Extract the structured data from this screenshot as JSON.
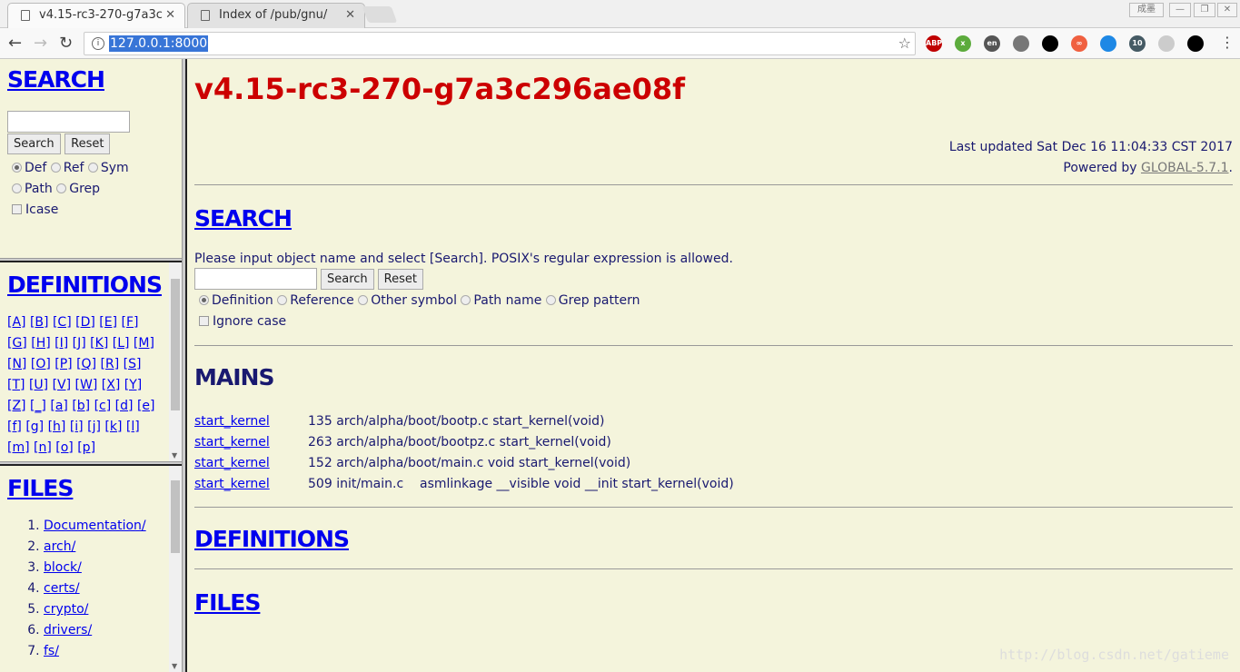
{
  "browser": {
    "tabs": [
      {
        "title": "v4.15-rc3-270-g7a3c",
        "active": true
      },
      {
        "title": "Index of /pub/gnu/",
        "active": false
      }
    ],
    "window_buttons": [
      "成墨",
      "—",
      "❐",
      "✕"
    ],
    "url": "127.0.0.1:8000",
    "extensions": [
      {
        "name": "adblock-plus-icon",
        "label": "ABP",
        "color": "#c00000"
      },
      {
        "name": "extension-x-icon",
        "label": "x",
        "color": "#5cab3c"
      },
      {
        "name": "translate-en-icon",
        "label": "en",
        "color": "#555555"
      },
      {
        "name": "extension-script-icon",
        "label": "",
        "color": "#777777"
      },
      {
        "name": "ring-icon",
        "label": "",
        "color": "#000000"
      },
      {
        "name": "infinity-icon",
        "label": "∞",
        "color": "#f06040"
      },
      {
        "name": "key-icon",
        "label": "",
        "color": "#1e88e5"
      },
      {
        "name": "star-badge-icon",
        "label": "10",
        "color": "#455a64"
      },
      {
        "name": "puzzle-icon",
        "label": "",
        "color": "#cccccc"
      },
      {
        "name": "gnome-foot-icon",
        "label": "",
        "color": "#000000"
      }
    ]
  },
  "left": {
    "search": {
      "title": "SEARCH",
      "search_btn": "Search",
      "reset_btn": "Reset",
      "radios": [
        "Def",
        "Ref",
        "Sym",
        "Path",
        "Grep"
      ],
      "checkbox": "Icase"
    },
    "definitions": {
      "title": "DEFINITIONS",
      "letters": [
        "[A]",
        "[B]",
        "[C]",
        "[D]",
        "[E]",
        "[F]",
        "[G]",
        "[H]",
        "[I]",
        "[J]",
        "[K]",
        "[L]",
        "[M]",
        "[N]",
        "[O]",
        "[P]",
        "[Q]",
        "[R]",
        "[S]",
        "[T]",
        "[U]",
        "[V]",
        "[W]",
        "[X]",
        "[Y]",
        "[Z]",
        "[_]",
        "[a]",
        "[b]",
        "[c]",
        "[d]",
        "[e]",
        "[f]",
        "[g]",
        "[h]",
        "[i]",
        "[j]",
        "[k]",
        "[l]",
        "[m]",
        "[n]",
        "[o]",
        "[p]"
      ]
    },
    "files": {
      "title": "FILES",
      "items": [
        "Documentation/",
        "arch/",
        "block/",
        "certs/",
        "crypto/",
        "drivers/",
        "fs/"
      ]
    }
  },
  "main": {
    "title": "v4.15-rc3-270-g7a3c296ae08f",
    "last_updated": "Last updated Sat Dec 16 11:04:33 CST 2017",
    "powered_prefix": "Powered by ",
    "powered_link": "GLOBAL-5.7.1",
    "powered_suffix": ".",
    "search": {
      "title": "SEARCH",
      "instructions": "Please input object name and select [Search]. POSIX's regular expression is allowed.",
      "search_btn": "Search",
      "reset_btn": "Reset",
      "radios": [
        "Definition",
        "Reference",
        "Other symbol",
        "Path name",
        "Grep pattern"
      ],
      "checkbox": "Ignore case"
    },
    "mains": {
      "title": "MAINS",
      "rows": [
        {
          "name": "start_kernel",
          "line": "135",
          "file": "arch/alpha/boot/bootp.c",
          "code": "start_kernel(void)"
        },
        {
          "name": "start_kernel",
          "line": "263",
          "file": "arch/alpha/boot/bootpz.c",
          "code": "start_kernel(void)"
        },
        {
          "name": "start_kernel",
          "line": "152",
          "file": "arch/alpha/boot/main.c",
          "code": "void start_kernel(void)"
        },
        {
          "name": "start_kernel",
          "line": "509",
          "file": "init/main.c",
          "code": "   asmlinkage __visible void __init start_kernel(void)"
        }
      ]
    },
    "definitions_title": "DEFINITIONS",
    "files_title": "FILES"
  },
  "watermark": "http://blog.csdn.net/gatieme",
  "colors": {
    "background": "#f4f4dc",
    "text": "#191970",
    "title": "#cc0000",
    "link": "#0000ee"
  }
}
